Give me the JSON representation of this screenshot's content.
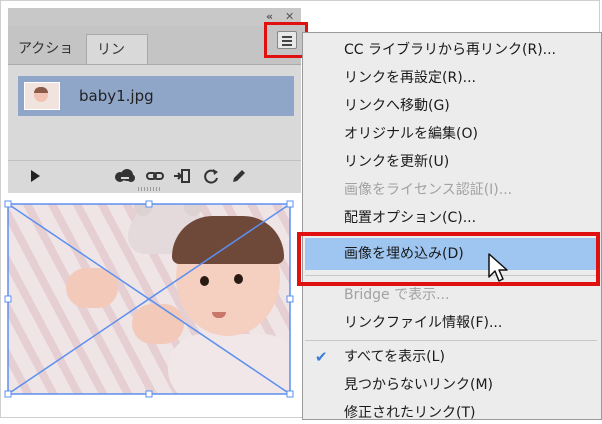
{
  "panel": {
    "collapse_glyph": "«",
    "close_glyph": "✕",
    "tabs": [
      {
        "label": "アクション",
        "active": false
      },
      {
        "label": "リンク",
        "active": true
      }
    ],
    "menu_icon": "hamburger-icon",
    "links": [
      {
        "name": "baby1.jpg",
        "selected": true
      }
    ],
    "toolbar_icons": [
      "play-icon",
      "cc-library-link-icon",
      "relink-icon",
      "go-to-link-icon",
      "update-link-icon",
      "edit-original-icon"
    ]
  },
  "menu": {
    "items": [
      {
        "label": "CC ライブラリから再リンク(R)...",
        "enabled": true
      },
      {
        "label": "リンクを再設定(R)...",
        "enabled": true
      },
      {
        "label": "リンクへ移動(G)",
        "enabled": true
      },
      {
        "label": "オリジナルを編集(O)",
        "enabled": true
      },
      {
        "label": "リンクを更新(U)",
        "enabled": true
      },
      {
        "label": "画像をライセンス認証(I)...",
        "enabled": false
      },
      {
        "label": "配置オプション(C)...",
        "enabled": true
      },
      {
        "label": "画像を埋め込み(D)",
        "enabled": true,
        "highlighted": true
      },
      {
        "label": "Bridge で表示...",
        "enabled": false
      },
      {
        "label": "リンクファイル情報(F)...",
        "enabled": true
      },
      {
        "label": "すべてを表示(L)",
        "enabled": true,
        "checked": true
      },
      {
        "label": "見つからないリンク(M)",
        "enabled": true
      },
      {
        "label": "修正されたリンク(T)",
        "enabled": true
      }
    ],
    "check_glyph": "✔"
  },
  "colors": {
    "highlight_box": "#e01010",
    "menu_highlight": "#9ec6f1",
    "selected_row": "#8fa6c9",
    "frame_line": "#5b8ff0"
  }
}
